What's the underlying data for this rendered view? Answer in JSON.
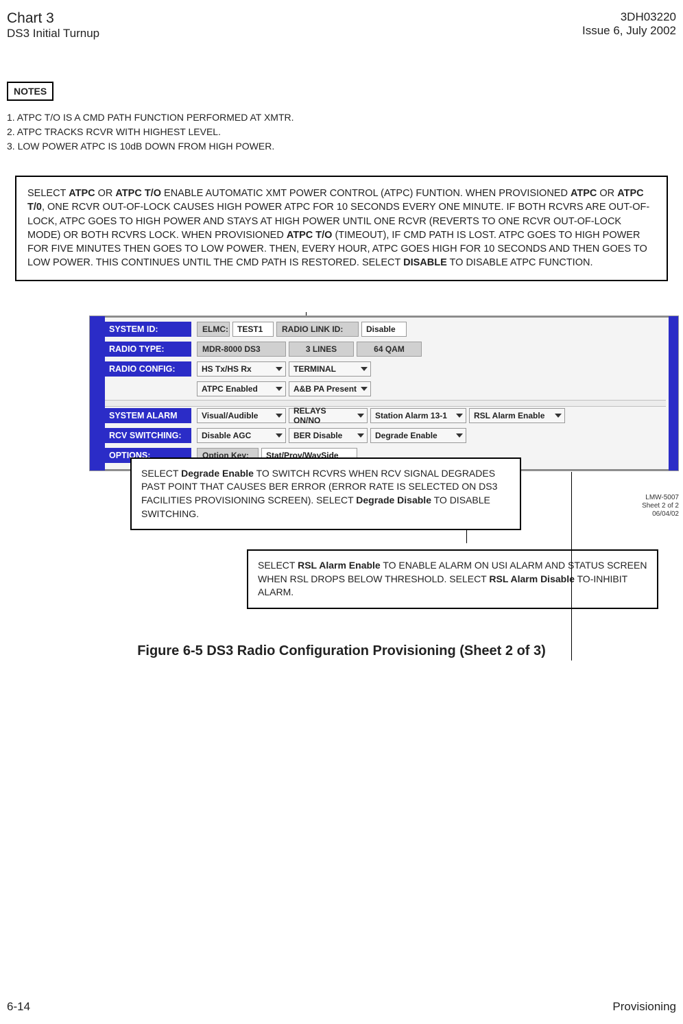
{
  "header": {
    "chart_title": "Chart 3",
    "chart_subtitle": "DS3 Initial Turnup",
    "doc_number": "3DH03220",
    "issue": "Issue 6, July 2002"
  },
  "notes": {
    "label": "NOTES",
    "lines": [
      "1. ATPC T/O IS A CMD PATH FUNCTION PERFORMED AT XMTR.",
      "2. ATPC TRACKS RCVR WITH HIGHEST LEVEL.",
      "3. LOW POWER ATPC IS 10dB DOWN FROM HIGH POWER."
    ]
  },
  "main_callout": {
    "pre1": "SELECT ",
    "b1": "ATPC",
    "mid1": " OR ",
    "b2": "ATPC T/O",
    "post1": " ENABLE AUTOMATIC XMT POWER CONTROL (ATPC) FUNTION. WHEN PROVISIONED ",
    "b3": "ATPC",
    "mid2": " OR ",
    "b4": "ATPC T/0",
    "post2": ", ONE RCVR OUT-OF-LOCK CAUSES HIGH POWER ATPC FOR 10 SECONDS EVERY ONE MINUTE. IF BOTH RCVRS ARE OUT-OF-LOCK, ATPC GOES TO HIGH POWER AND STAYS AT HIGH POWER UNTIL ONE RCVR (REVERTS TO ONE RCVR OUT-OF-LOCK MODE) OR BOTH RCVRS LOCK. WHEN PROVISIONED ",
    "b5": "ATPC T/O",
    "post3": " (TIMEOUT), IF CMD PATH IS LOST. ATPC GOES TO HIGH POWER FOR FIVE MINUTES THEN GOES TO LOW POWER. THEN, EVERY HOUR, ATPC GOES HIGH FOR 10 SECONDS AND THEN GOES TO LOW POWER. THIS CONTINUES UNTIL THE CMD PATH IS RESTORED. SELECT ",
    "b6": "DISABLE",
    "post4": " TO DISABLE ATPC FUNCTION."
  },
  "panel": {
    "system_id_label": "SYSTEM ID:",
    "elmc_label": "ELMC:",
    "elmc_value": "TEST1",
    "radio_link_id_label": "RADIO LINK ID:",
    "radio_link_id_value": "Disable",
    "radio_type_label": "RADIO TYPE:",
    "radio_type_v1": "MDR-8000 DS3",
    "radio_type_v2": "3 LINES",
    "radio_type_v3": "64 QAM",
    "radio_config_label": "RADIO CONFIG:",
    "radio_config_v1": "HS Tx/HS Rx",
    "radio_config_v2": "TERMINAL",
    "radio_config_v3": "ATPC Enabled",
    "radio_config_v4": "A&B PA Present",
    "system_alarm_label": "SYSTEM ALARM",
    "sa_v1": "Visual/Audible",
    "sa_v2": "RELAYS ON/NO",
    "sa_v3": "Station Alarm 13-1",
    "sa_v4": "RSL Alarm Enable",
    "rcv_switching_label": "RCV SWITCHING:",
    "rcv_v1": "Disable AGC",
    "rcv_v2": "BER Disable",
    "rcv_v3": "Degrade Enable",
    "options_label": "OPTIONS:",
    "option_key_label": "Option Key:",
    "option_key_value": "Stat/Prov/WaySide"
  },
  "stamp": {
    "l1": "LMW-5007",
    "l2": "Sheet 2 of 2",
    "l3": "06/04/02"
  },
  "callout_degrade": {
    "pre": "SELECT ",
    "b1": "Degrade Enable",
    "mid": " TO SWITCH RCVRS WHEN RCV SIGNAL DEGRADES PAST POINT THAT CAUSES BER ERROR (ERROR RATE IS SELECTED ON DS3 FACILITIES PROVISIONING SCREEN). SELECT ",
    "b2": "Degrade Disable",
    "post": " TO DISABLE SWITCHING."
  },
  "callout_rsl": {
    "pre": "SELECT ",
    "b1": "RSL Alarm Enable",
    "mid": " TO ENABLE ALARM ON USI ALARM AND STATUS SCREEN WHEN RSL DROPS BELOW THRESHOLD. SELECT ",
    "b2": "RSL Alarm Disable",
    "post": " TO-INHIBIT ALARM."
  },
  "figure_title": "Figure 6-5  DS3 Radio Configuration Provisioning (Sheet 2 of 3)",
  "footer": {
    "page": "6-14",
    "label": "Provisioning"
  }
}
